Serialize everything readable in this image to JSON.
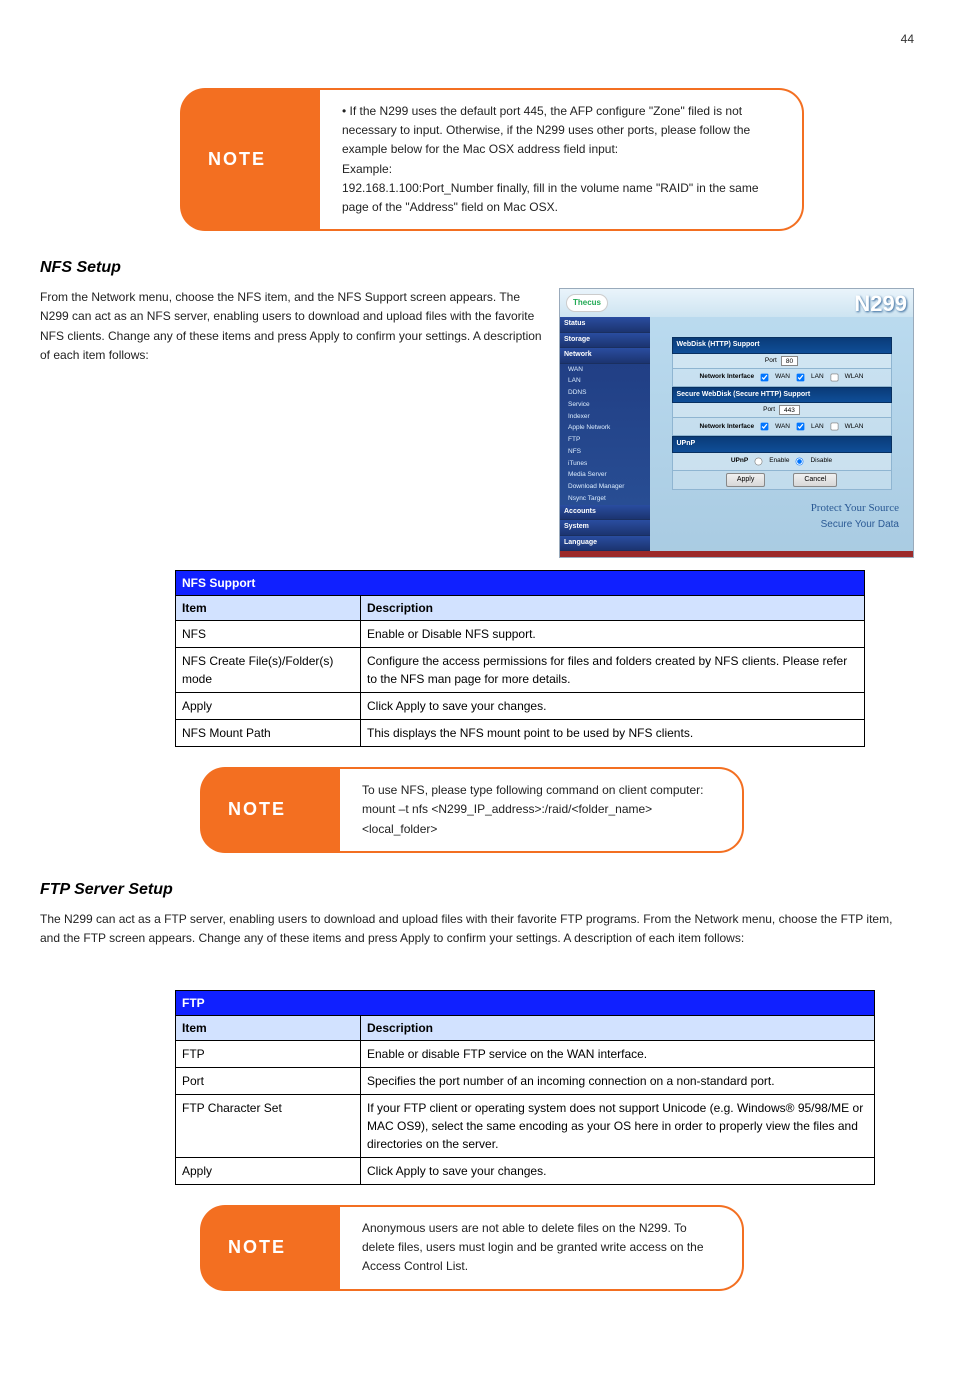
{
  "page_number": "44",
  "note1": {
    "label": "NOTE",
    "text": "• If the N299 uses the default port 445, the AFP configure \"Zone\" filed is not necessary to input. Otherwise, if the N299 uses other ports, please follow the example below for the Mac OSX address field input:\nExample:\n192.168.1.100:Port_Number finally, fill in the volume name \"RAID\" in the same page of the \"Address\" field on Mac OSX."
  },
  "section1": {
    "heading": "NFS Setup",
    "para": "From the Network menu, choose the NFS item, and the NFS Support screen appears. The N299 can act as an NFS server, enabling users to download and upload files with the favorite NFS clients. Change any of these items and press Apply to confirm your settings. A description of each item follows:"
  },
  "shot": {
    "logo": "Thecus",
    "model": "N299",
    "nav_headers": [
      "Status",
      "Storage",
      "Network"
    ],
    "nav_items": [
      "WAN",
      "LAN",
      "DDNS",
      "Service",
      "Indexer",
      "Apple Network",
      "FTP",
      "NFS",
      "iTunes",
      "Media Server",
      "Download Manager",
      "Nsync Target"
    ],
    "nav_footers": [
      "Accounts",
      "System",
      "Language"
    ],
    "panel1_title": "WebDisk (HTTP) Support",
    "port_label": "Port",
    "port80": "80",
    "ni_label": "Network Interface",
    "wan": "WAN",
    "lan": "LAN",
    "wlan": "WLAN",
    "panel2_title": "Secure WebDisk (Secure HTTP) Support",
    "port443": "443",
    "panel3_title": "UPnP",
    "upnp_label": "UPnP",
    "enable": "Enable",
    "disable": "Disable",
    "apply": "Apply",
    "cancel": "Cancel",
    "protect": "Protect Your Source",
    "secure_data": "Secure Your Data"
  },
  "table1": {
    "title": "NFS Support",
    "col1": "Item",
    "col2": "Description",
    "rows": [
      {
        "item": "NFS",
        "desc": "Enable or Disable NFS support."
      },
      {
        "item": "NFS Create File(s)/Folder(s) mode",
        "desc": "Configure the access permissions for files and folders created by NFS clients. Please refer to the NFS man page for more details."
      },
      {
        "item": "Apply",
        "desc": "Click Apply to save your changes."
      },
      {
        "item": "NFS Mount Path",
        "desc": "This displays the NFS mount point to be used by NFS clients."
      }
    ]
  },
  "note2": {
    "label": "NOTE",
    "text": "To use NFS, please type following command on client computer:\nmount –t nfs <N299_IP_address>:/raid/<folder_name> <local_folder>"
  },
  "section2": {
    "heading": "FTP Server Setup",
    "para": "The N299 can act as a FTP server, enabling users to download and upload files with their favorite FTP programs. From the Network menu, choose the FTP item, and the FTP screen appears. Change any of these items and press Apply to confirm your settings. A description of each item follows:"
  },
  "table2": {
    "title": "FTP",
    "col1": "Item",
    "col2": "Description",
    "rows": [
      {
        "item": "FTP",
        "desc": "Enable or disable FTP service on the WAN interface."
      },
      {
        "item": "Port",
        "desc": "Specifies the port number of an incoming connection on a non-standard port."
      },
      {
        "item": "FTP Character Set",
        "desc": "If your FTP client or operating system does not support Unicode (e.g. Windows® 95/98/ME or MAC OS9), select the same encoding as your OS here in order to properly view the files and directories on the server."
      },
      {
        "item": "Apply",
        "desc": "Click Apply to save your changes."
      }
    ]
  },
  "note3": {
    "label": "NOTE",
    "text": "Anonymous users are not able to delete files on the N299. To delete files, users must login and be granted write access on the Access Control List."
  }
}
